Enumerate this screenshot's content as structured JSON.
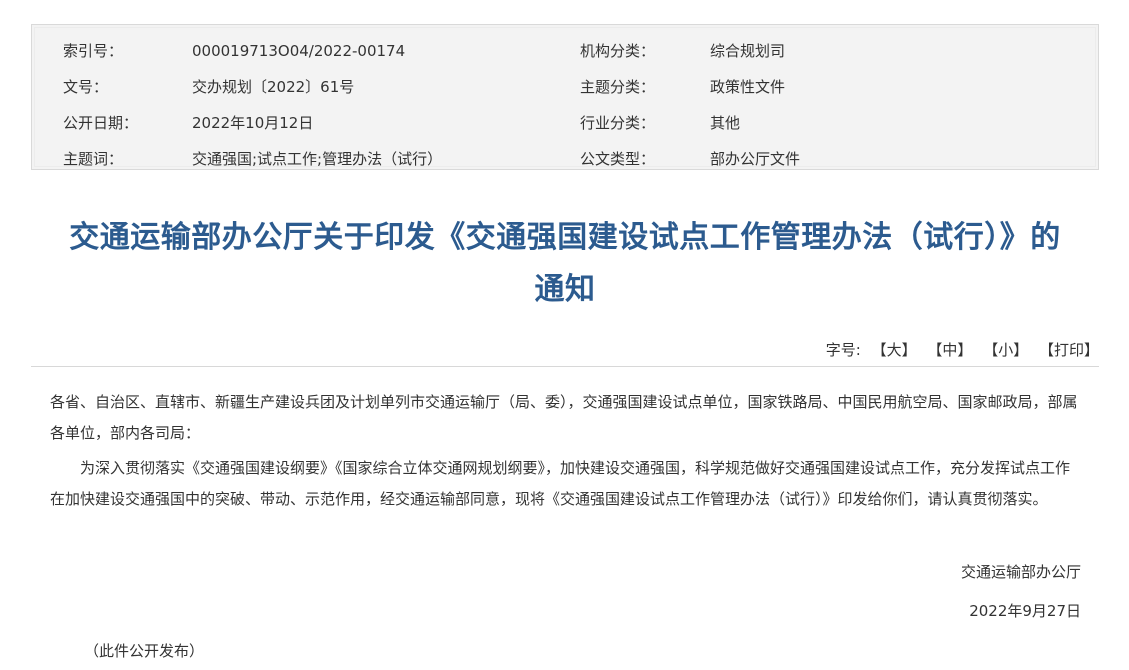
{
  "metadata": {
    "rows": [
      {
        "k1": "索引号：",
        "v1": "000019713O04/2022-00174",
        "k2": "机构分类：",
        "v2": "综合规划司"
      },
      {
        "k1": "文号：",
        "v1": "交办规划〔2022〕61号",
        "k2": "主题分类：",
        "v2": "政策性文件"
      },
      {
        "k1": "公开日期：",
        "v1": "2022年10月12日",
        "k2": "行业分类：",
        "v2": "其他"
      },
      {
        "k1": "主题词：",
        "v1": "交通强国;试点工作;管理办法（试行）",
        "k2": "公文类型：",
        "v2": "部办公厅文件"
      }
    ]
  },
  "document": {
    "title_line1": "交通运输部办公厅关于印发《交通强国建设试点工作管理办法（试行）》的",
    "title_line2": "通知",
    "addressees": "各省、自治区、直辖市、新疆生产建设兵团及计划单列市交通运输厅（局、委），交通强国建设试点单位，国家铁路局、中国民用航空局、国家邮政局，部属各单位，部内各司局：",
    "body": "为深入贯彻落实《交通强国建设纲要》《国家综合立体交通网规划纲要》，加快建设交通强国，科学规范做好交通强国建设试点工作，充分发挥试点工作在加快建设交通强国中的突破、带动、示范作用，经交通运输部同意，现将《交通强国建设试点工作管理办法（试行）》印发给你们，请认真贯彻落实。",
    "signature": "交通运输部办公厅",
    "date": "2022年9月27日",
    "note": "（此件公开发布）"
  },
  "font_tools": {
    "label": "字号:",
    "large": "【大】",
    "medium": "【中】",
    "small": "【小】",
    "print": "【打印】"
  },
  "colors": {
    "title": "#2c5b8f",
    "meta_background": "#f3f3f3",
    "text": "#333333"
  }
}
